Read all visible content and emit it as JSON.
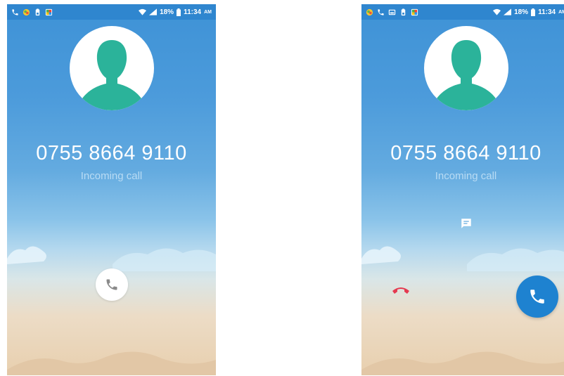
{
  "screens": [
    {
      "status": {
        "battery": "18%",
        "time": "11:34",
        "ampm": "AM",
        "left_icons": [
          "call-icon",
          "photos-icon",
          "battery-saver-icon",
          "gallery-icon"
        ]
      },
      "caller": {
        "number": "0755 8664 9110",
        "status": "Incoming call"
      },
      "controls": [
        "answer-button"
      ]
    },
    {
      "status": {
        "battery": "18%",
        "time": "11:34",
        "ampm": "AM",
        "left_icons": [
          "photos-icon",
          "call-icon",
          "screenshot-icon",
          "battery-saver-icon",
          "gallery-icon"
        ]
      },
      "caller": {
        "number": "0755 8664 9110",
        "status": "Incoming call"
      },
      "controls": [
        "message-button",
        "decline-button",
        "answer-button"
      ]
    }
  ],
  "colors": {
    "status_bar": "#2f86cf",
    "avatar_figure": "#2bb39a",
    "answer_button": "#1e82d0",
    "decline_icon": "#e53950",
    "answer_icon_light": "#8a8a8a"
  }
}
